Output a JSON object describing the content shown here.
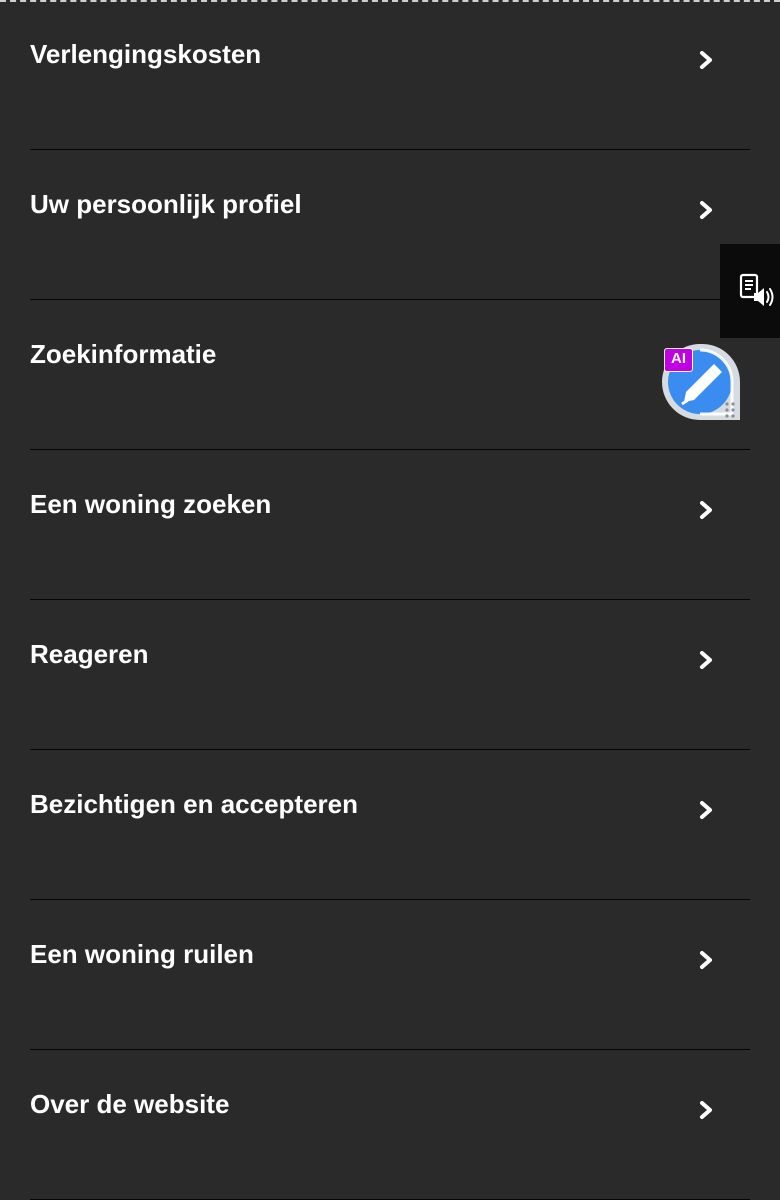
{
  "menu": {
    "items": [
      {
        "label": "Verlengingskosten",
        "has_chevron": true
      },
      {
        "label": "Uw persoonlijk profiel",
        "has_chevron": true
      },
      {
        "label": "Zoekinformatie",
        "has_chevron": false
      },
      {
        "label": "Een woning zoeken",
        "has_chevron": true
      },
      {
        "label": "Reageren",
        "has_chevron": true
      },
      {
        "label": "Bezichtigen en accepteren",
        "has_chevron": true
      },
      {
        "label": "Een woning ruilen",
        "has_chevron": true
      },
      {
        "label": "Over de website",
        "has_chevron": true
      }
    ],
    "chevron_icon": "chevron-right-icon"
  },
  "overlay": {
    "read_aloud_icon": "speaker-document-icon",
    "ai_widget": {
      "badge": "AI",
      "icon": "ai-pen-icon",
      "badge_color": "#c200e6",
      "accent_color": "#3b8cf0"
    }
  },
  "colors": {
    "background": "#2a2a2a",
    "text": "#ffffff",
    "divider": "#050505"
  }
}
